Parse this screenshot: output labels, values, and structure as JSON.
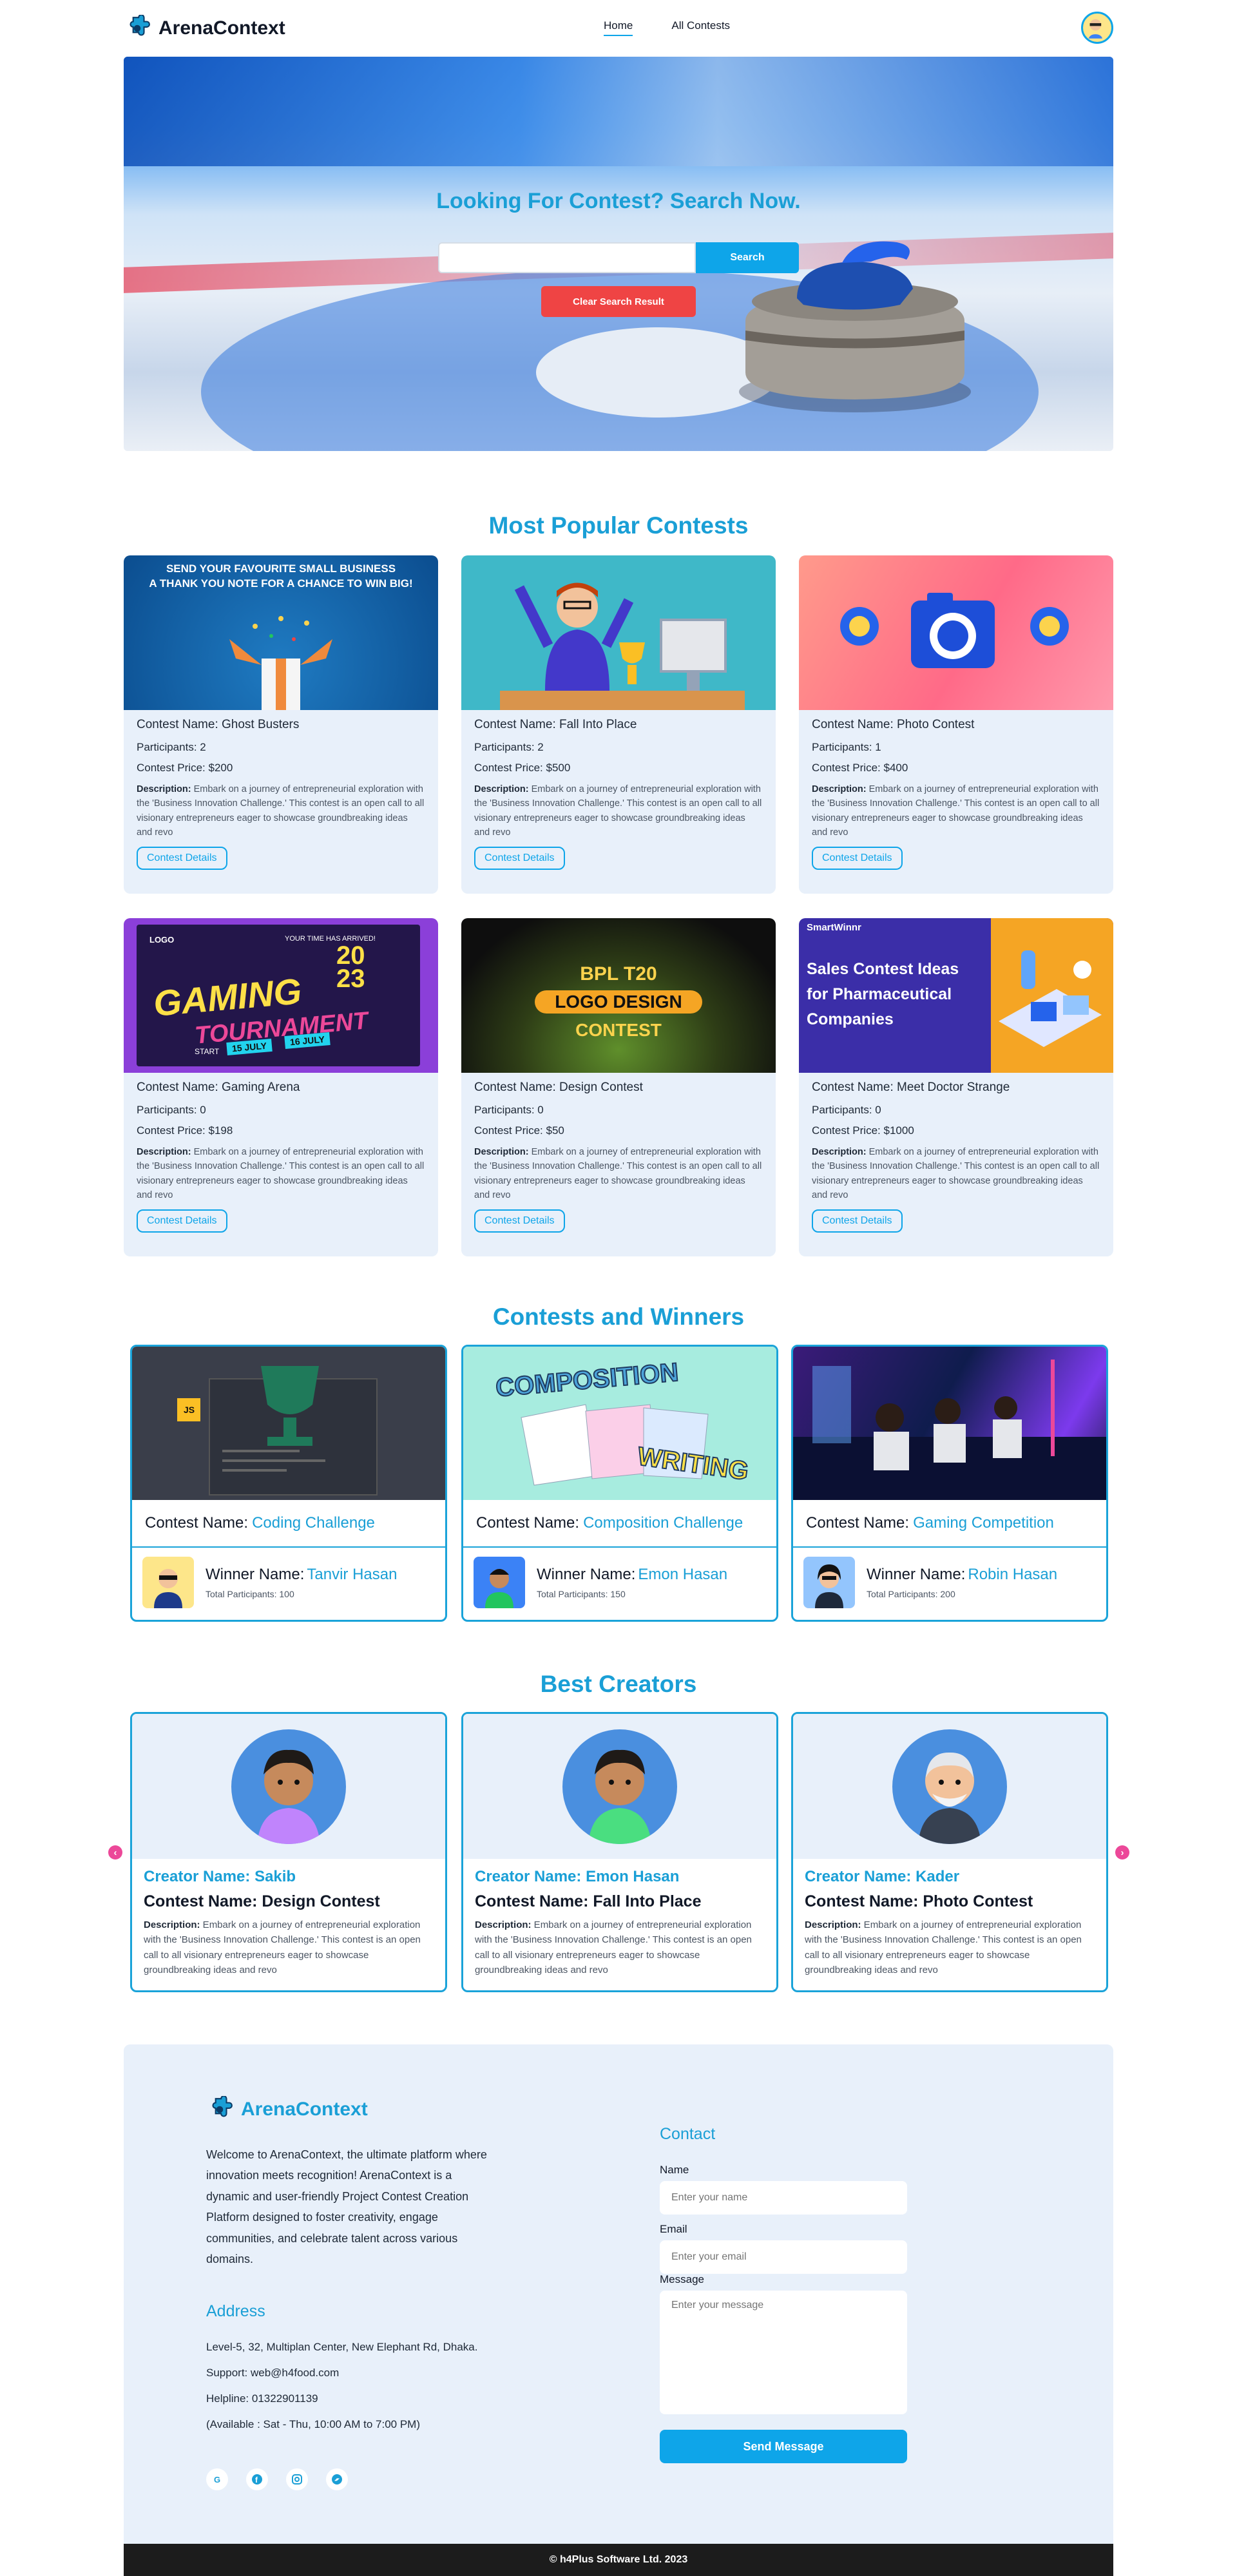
{
  "brand": {
    "name": "ArenaContext"
  },
  "nav": {
    "home": "Home",
    "all_contests": "All Contests"
  },
  "hero": {
    "title": "Looking For Contest? Search Now.",
    "search_placeholder": "",
    "search_button": "Search",
    "clear_button": "Clear Search Result"
  },
  "popular": {
    "title": "Most Popular Contests",
    "name_label": "Contest Name: ",
    "participants_label": "Participants: ",
    "price_label": "Contest Price: ",
    "desc_label": "Description:",
    "details_button": "Contest Details",
    "cards": [
      {
        "name": "Ghost Busters",
        "participants": "2",
        "price": "$200",
        "banner_line1": "SEND YOUR FAVOURITE SMALL BUSINESS",
        "banner_line2": "A THANK YOU NOTE FOR A CHANCE TO WIN BIG!",
        "desc": " Embark on a journey of entrepreneurial exploration with the 'Business Innovation Challenge.' This contest is an open call to all visionary entrepreneurs eager to showcase groundbreaking ideas and revo"
      },
      {
        "name": "Fall Into Place",
        "participants": "2",
        "price": "$500",
        "desc": " Embark on a journey of entrepreneurial exploration with the 'Business Innovation Challenge.' This contest is an open call to all visionary entrepreneurs eager to showcase groundbreaking ideas and revo"
      },
      {
        "name": "Photo Contest",
        "participants": "1",
        "price": "$400",
        "desc": " Embark on a journey of entrepreneurial exploration with the 'Business Innovation Challenge.' This contest is an open call to all visionary entrepreneurs eager to showcase groundbreaking ideas and revo"
      },
      {
        "name": "Gaming Arena",
        "participants": "0",
        "price": "$198",
        "banner_logo": "LOGO",
        "banner_tag": "YOUR TIME HAS ARRIVED!",
        "banner_year_a": "20",
        "banner_year_b": "23",
        "banner_line1": "GAMING",
        "banner_line2": "TOURNAMENT",
        "banner_start": "START",
        "banner_date1": "15 JULY",
        "banner_date2": "16 JULY",
        "desc": " Embark on a journey of entrepreneurial exploration with the 'Business Innovation Challenge.' This contest is an open call to all visionary entrepreneurs eager to showcase groundbreaking ideas and revo"
      },
      {
        "name": "Design Contest",
        "participants": "0",
        "price": "$50",
        "banner_line1": "BPL T20",
        "banner_line2": "LOGO DESIGN",
        "banner_line3": "CONTEST",
        "desc": " Embark on a journey of entrepreneurial exploration with the 'Business Innovation Challenge.' This contest is an open call to all visionary entrepreneurs eager to showcase groundbreaking ideas and revo"
      },
      {
        "name": "Meet Doctor Strange",
        "participants": "0",
        "price": "$1000",
        "banner_brand": "SmartWinnr",
        "banner_line1": "Sales Contest Ideas",
        "banner_line2": "for Pharmaceutical",
        "banner_line3": "Companies",
        "desc": " Embark on a journey of entrepreneurial exploration with the 'Business Innovation Challenge.' This contest is an open call to all visionary entrepreneurs eager to showcase groundbreaking ideas and revo"
      }
    ]
  },
  "winners": {
    "title": "Contests and Winners",
    "contest_label": "Contest Name:",
    "winner_label": "Winner Name:",
    "participants_label": "Total Participants: ",
    "cards": [
      {
        "contest": "Coding Challenge",
        "winner": "Tanvir Hasan",
        "participants": "100",
        "banner_badge": "JS"
      },
      {
        "contest": "Composition Challenge",
        "winner": "Emon Hasan",
        "participants": "150",
        "banner_line1": "COMPOSITION",
        "banner_line2": "WRITING"
      },
      {
        "contest": "Gaming Competition",
        "winner": "Robin Hasan",
        "participants": "200"
      }
    ]
  },
  "creators": {
    "title": "Best Creators",
    "creator_label": "Creator Name: ",
    "contest_label": "Contest Name: ",
    "desc_label": "Description:",
    "cards": [
      {
        "creator": "Sakib",
        "contest": "Design Contest",
        "desc": " Embark on a journey of entrepreneurial exploration with the 'Business Innovation Challenge.' This contest is an open call to all visionary entrepreneurs eager to showcase groundbreaking ideas and revo"
      },
      {
        "creator": "Emon Hasan",
        "contest": "Fall Into Place",
        "desc": " Embark on a journey of entrepreneurial exploration with the 'Business Innovation Challenge.' This contest is an open call to all visionary entrepreneurs eager to showcase groundbreaking ideas and revo"
      },
      {
        "creator": "Kader",
        "contest": "Photo Contest",
        "desc": " Embark on a journey of entrepreneurial exploration with the 'Business Innovation Challenge.' This contest is an open call to all visionary entrepreneurs eager to showcase groundbreaking ideas and revo"
      }
    ],
    "prev_icon": "chevron-left-icon",
    "next_icon": "chevron-right-icon"
  },
  "footer": {
    "brand": "ArenaContext",
    "about": "Welcome to ArenaContext, the ultimate platform where innovation meets recognition! ArenaContext is a dynamic and user-friendly Project Contest Creation Platform designed to foster creativity, engage communities, and celebrate talent across various domains.",
    "address_title": "Address",
    "address": "Level-5, 32, Multiplan Center, New Elephant Rd, Dhaka.",
    "support": "Support: web@h4food.com",
    "helpline": "Helpline: 01322901139",
    "availability": "(Available : Sat - Thu, 10:00 AM to 7:00 PM)",
    "social_icons": [
      "google-icon",
      "facebook-icon",
      "instagram-icon",
      "twitter-icon"
    ],
    "contact_title": "Contact",
    "name_label": "Name",
    "name_placeholder": "Enter your name",
    "email_label": "Email",
    "email_placeholder": "Enter your email",
    "message_label": "Message",
    "message_placeholder": "Enter your message",
    "send_button": "Send Message",
    "copyright": "© h4Plus Software Ltd. 2023"
  },
  "colors": {
    "accent": "#0ea5e9",
    "heading": "#1a9fd6",
    "danger": "#ef4444",
    "card_bg": "#e8f0fa",
    "arrow": "#ec4899"
  }
}
